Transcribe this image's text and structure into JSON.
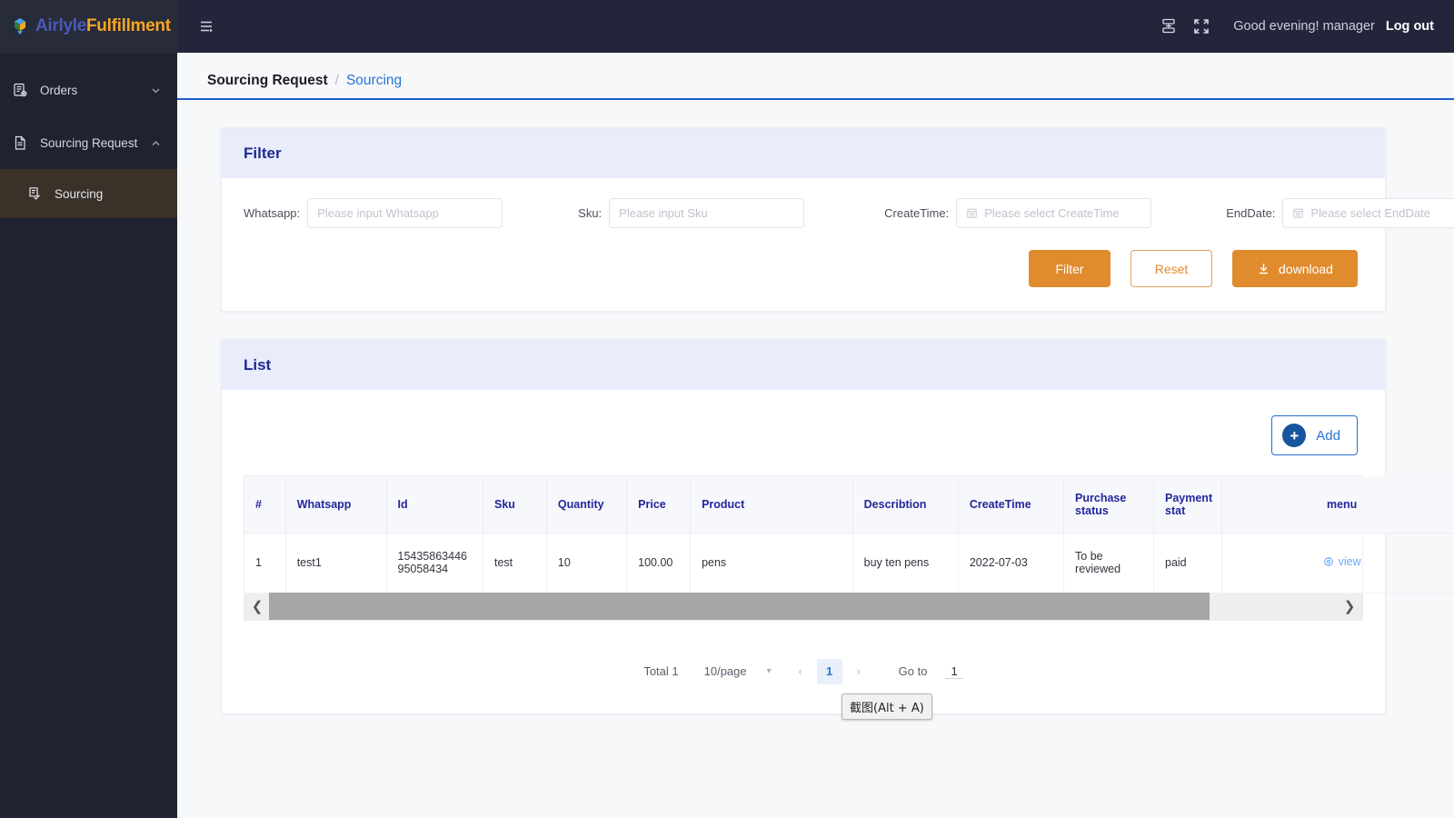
{
  "brand": {
    "name_part1": "Airlyle",
    "name_part2": "Fulfillment",
    "color_part1": "#4a5ab8",
    "color_part2": "#f5a623"
  },
  "topbar": {
    "greeting": "Good evening! manager",
    "logout_label": "Log out",
    "fold_icon": "hamburger-fold-icon",
    "sitemap_icon": "sitemap-icon",
    "fullscreen_icon": "fullscreen-icon"
  },
  "sidebar": {
    "items": [
      {
        "label": "Orders",
        "icon": "orders-icon",
        "chevron": "chevron-down",
        "active": false
      },
      {
        "label": "Sourcing Request",
        "icon": "document-icon",
        "chevron": "chevron-up",
        "active": false
      }
    ],
    "sub_items": [
      {
        "label": "Sourcing",
        "icon": "sourcing-icon",
        "active": true
      }
    ]
  },
  "breadcrumb": {
    "root": "Sourcing Request",
    "separator": "/",
    "current": "Sourcing"
  },
  "filter": {
    "title": "Filter",
    "fields": [
      {
        "label": "Whatsapp:",
        "placeholder": "Please input Whatsapp",
        "value": "",
        "type": "text"
      },
      {
        "label": "Sku:",
        "placeholder": "Please input Sku",
        "value": "",
        "type": "text"
      },
      {
        "label": "CreateTime:",
        "placeholder": "Please select CreateTime",
        "value": "",
        "type": "date"
      },
      {
        "label": "EndDate:",
        "placeholder": "Please select EndDate",
        "value": "",
        "type": "date"
      }
    ],
    "buttons": {
      "filter": "Filter",
      "reset": "Reset",
      "download": "download"
    },
    "accent_color": "#e08b2e"
  },
  "list": {
    "title": "List",
    "add_label": "Add",
    "columns": [
      "#",
      "Whatsapp",
      "Id",
      "Sku",
      "Quantity",
      "Price",
      "Product",
      "Describtion",
      "CreateTime",
      "Purchase status",
      "Payment stat",
      "menu"
    ],
    "rows": [
      {
        "index": "1",
        "whatsapp": "test1",
        "id": "1543586344695058434",
        "sku": "test",
        "quantity": "10",
        "price": "100.00",
        "product": "pens",
        "describtion": "buy ten pens",
        "createtime": "2022-07-03",
        "purchase_status": "To be reviewed",
        "payment_status": "paid",
        "menu_action": "view"
      }
    ]
  },
  "pagination": {
    "total_label": "Total 1",
    "page_size": "10/page",
    "prev": "‹",
    "next": "›",
    "current_page": "1",
    "goto_label": "Go to",
    "goto_value": "1"
  },
  "tooltip": {
    "text": "截图(Alt + A)"
  }
}
